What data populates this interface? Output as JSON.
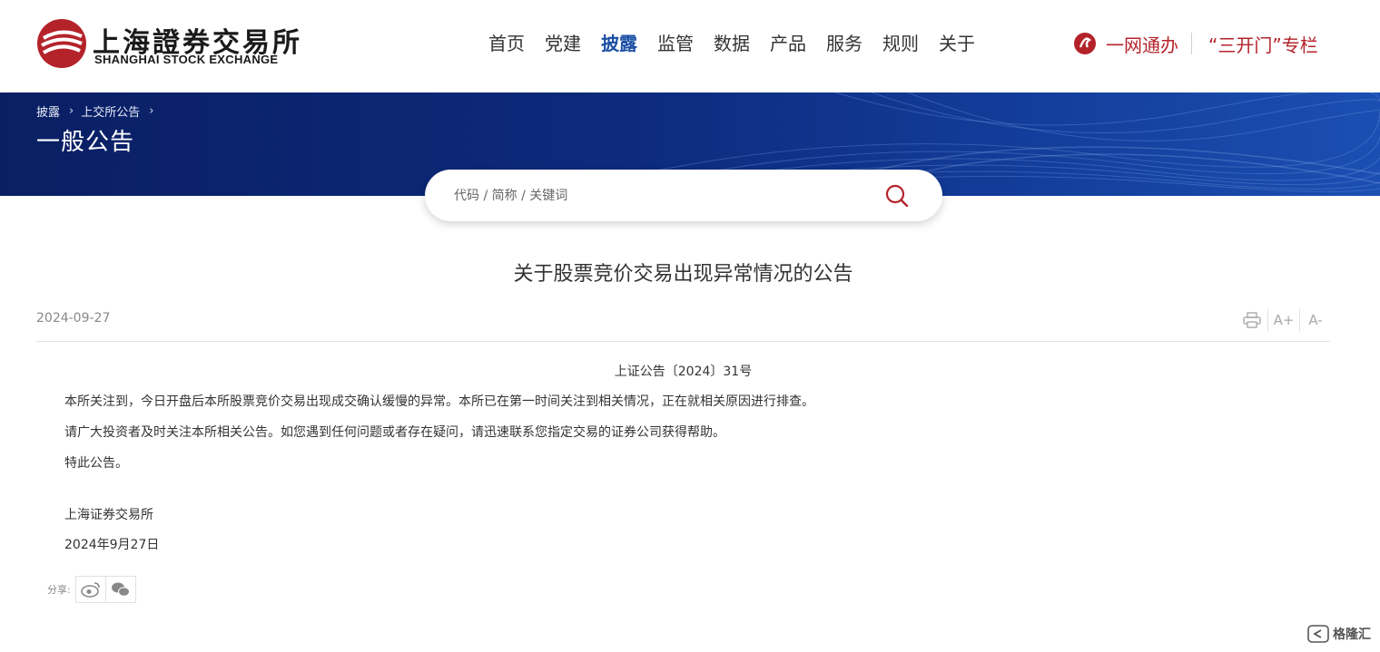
{
  "header": {
    "logo_text_cn": "上海證券交易所",
    "logo_text_en": "SHANGHAI STOCK EXCHANGE",
    "nav": [
      {
        "label": "首页",
        "active": false
      },
      {
        "label": "党建",
        "active": false
      },
      {
        "label": "披露",
        "active": true
      },
      {
        "label": "监管",
        "active": false
      },
      {
        "label": "数据",
        "active": false
      },
      {
        "label": "产品",
        "active": false
      },
      {
        "label": "服务",
        "active": false
      },
      {
        "label": "规则",
        "active": false
      },
      {
        "label": "关于",
        "active": false
      }
    ],
    "quick_links": {
      "one_network": "一网通办",
      "three_open": "“三开门”专栏"
    }
  },
  "banner": {
    "breadcrumb": [
      "披露",
      "上交所公告"
    ],
    "title": "一般公告"
  },
  "search": {
    "placeholder": "代码 / 简称 / 关键词"
  },
  "article": {
    "title": "关于股票竞价交易出现异常情况的公告",
    "date": "2024-09-27",
    "tools": {
      "increase_font": "A+",
      "decrease_font": "A-"
    },
    "doc_number": "上证公告〔2024〕31号",
    "paragraphs": [
      "本所关注到，今日开盘后本所股票竞价交易出现成交确认缓慢的异常。本所已在第一时间关注到相关情况，正在就相关原因进行排查。",
      "请广大投资者及时关注本所相关公告。如您遇到任何问题或者存在疑问，请迅速联系您指定交易的证券公司获得帮助。",
      "特此公告。"
    ],
    "signature": "上海证券交易所",
    "signature_date": "2024年9月27日"
  },
  "share": {
    "label": "分享:"
  },
  "watermark": {
    "text": "格隆汇"
  },
  "colors": {
    "brand_red": "#b4232a",
    "nav_active": "#1a4ea3",
    "banner_dark": "#0a1f63"
  }
}
